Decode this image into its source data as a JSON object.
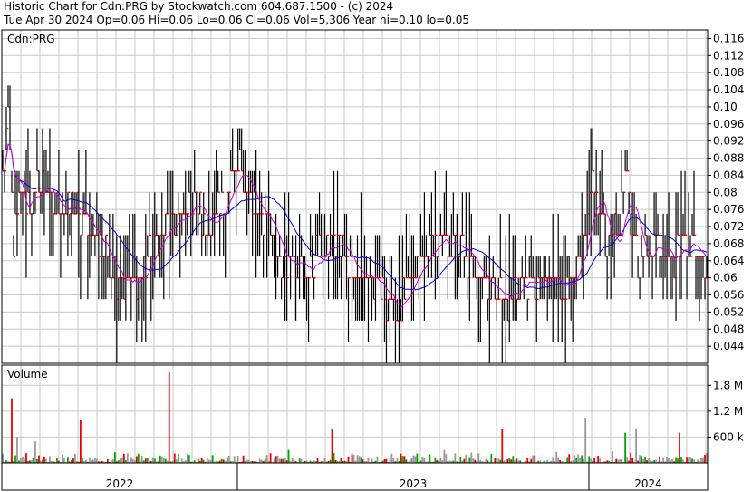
{
  "header": {
    "line1": "Historic Chart for Cdn:PRG by Stockwatch.com 604.687.1500 - (c) 2024",
    "line2": "Tue Apr 30 2024  Op=0.06  Hi=0.06  Lo=0.06  Cl=0.06  Vol=5,306  Year hi=0.10  lo=0.05"
  },
  "colors": {
    "grid": "#c8c8c8",
    "frame": "#000000",
    "price_bar": "#000000",
    "close_tick": "#ff0000",
    "ma_short": "#cc00cc",
    "ma_long": "#0000cc",
    "vol_up": "#00aa00",
    "vol_down": "#ee0000",
    "vol_flat": "#999999"
  },
  "chart_data": [
    {
      "type": "ohlc",
      "title": "Cdn:PRG",
      "ylim": [
        0.04,
        0.118
      ],
      "yticks": [
        0.044,
        0.048,
        0.052,
        0.056,
        0.06,
        0.064,
        0.068,
        0.072,
        0.076,
        0.08,
        0.084,
        0.088,
        0.092,
        0.096,
        0.1,
        0.104,
        0.108,
        0.112,
        0.116
      ],
      "ytick_labels": [
        "0.044",
        "0.048",
        "0.052",
        "0.056",
        "0.06",
        "0.064",
        "0.068",
        "0.072",
        "0.076",
        "0.08",
        "0.084",
        "0.088",
        "0.092",
        "0.096",
        "0.10",
        "0.104",
        "0.108",
        "0.112",
        "0.116"
      ],
      "xticks": [
        "2022",
        "2023",
        "2024"
      ],
      "close_keyframes": [
        [
          0,
          0.085
        ],
        [
          3,
          0.095
        ],
        [
          6,
          0.07
        ],
        [
          10,
          0.08
        ],
        [
          16,
          0.078
        ],
        [
          22,
          0.082
        ],
        [
          30,
          0.076
        ],
        [
          38,
          0.078
        ],
        [
          45,
          0.072
        ],
        [
          52,
          0.07
        ],
        [
          58,
          0.066
        ],
        [
          62,
          0.062
        ],
        [
          68,
          0.058
        ],
        [
          74,
          0.06
        ],
        [
          80,
          0.064
        ],
        [
          86,
          0.07
        ],
        [
          94,
          0.072
        ],
        [
          100,
          0.075
        ],
        [
          106,
          0.078
        ],
        [
          112,
          0.072
        ],
        [
          118,
          0.074
        ],
        [
          124,
          0.08
        ],
        [
          130,
          0.086
        ],
        [
          135,
          0.08
        ],
        [
          142,
          0.076
        ],
        [
          148,
          0.07
        ],
        [
          154,
          0.064
        ],
        [
          160,
          0.066
        ],
        [
          168,
          0.062
        ],
        [
          176,
          0.066
        ],
        [
          184,
          0.068
        ],
        [
          192,
          0.064
        ],
        [
          200,
          0.06
        ],
        [
          206,
          0.058
        ],
        [
          212,
          0.054
        ],
        [
          218,
          0.053
        ],
        [
          224,
          0.057
        ],
        [
          230,
          0.063
        ],
        [
          236,
          0.067
        ],
        [
          242,
          0.069
        ],
        [
          248,
          0.068
        ],
        [
          254,
          0.066
        ],
        [
          260,
          0.062
        ],
        [
          266,
          0.06
        ],
        [
          272,
          0.057
        ],
        [
          278,
          0.055
        ],
        [
          284,
          0.058
        ],
        [
          290,
          0.06
        ],
        [
          296,
          0.058
        ],
        [
          302,
          0.059
        ],
        [
          308,
          0.058
        ],
        [
          314,
          0.061
        ],
        [
          320,
          0.064
        ],
        [
          326,
          0.082
        ],
        [
          330,
          0.076
        ],
        [
          334,
          0.065
        ],
        [
          340,
          0.072
        ],
        [
          344,
          0.085
        ],
        [
          348,
          0.072
        ],
        [
          352,
          0.064
        ],
        [
          358,
          0.066
        ],
        [
          364,
          0.069
        ],
        [
          370,
          0.064
        ],
        [
          376,
          0.07
        ],
        [
          382,
          0.066
        ],
        [
          388,
          0.064
        ]
      ],
      "ma_short_period": 10,
      "ma_long_period": 30
    },
    {
      "type": "bar",
      "title": "Volume",
      "ylim": [
        0,
        2100000
      ],
      "yticks": [
        600000,
        1200000,
        1800000
      ],
      "ytick_labels": [
        "600 k",
        "1.2 M",
        "1.8 M"
      ],
      "spikes": [
        [
          5,
          1500000
        ],
        [
          8,
          600000
        ],
        [
          18,
          500000
        ],
        [
          43,
          1000000
        ],
        [
          92,
          2100000
        ],
        [
          158,
          300000
        ],
        [
          182,
          800000
        ],
        [
          244,
          300000
        ],
        [
          276,
          800000
        ],
        [
          322,
          1050000
        ],
        [
          344,
          700000
        ],
        [
          350,
          800000
        ],
        [
          374,
          700000
        ]
      ]
    }
  ]
}
